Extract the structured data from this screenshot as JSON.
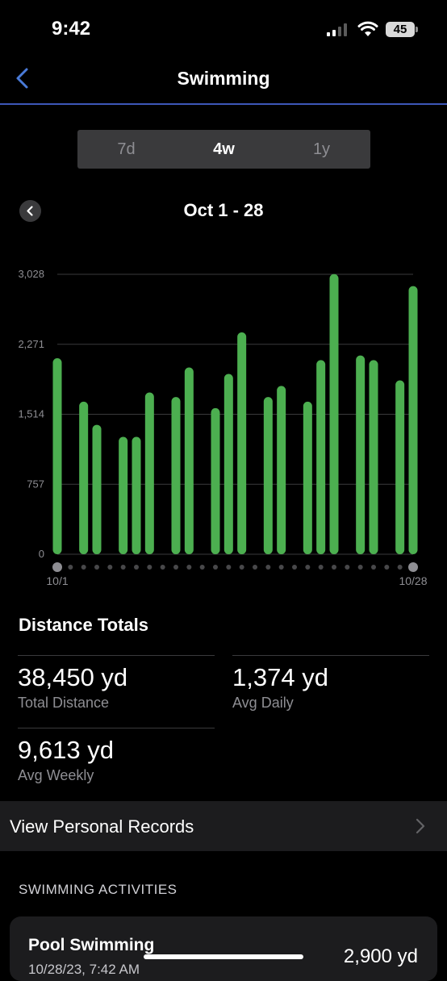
{
  "status_bar": {
    "time": "9:42",
    "battery": "45"
  },
  "nav": {
    "title": "Swimming"
  },
  "segmented": {
    "options": [
      "7d",
      "4w",
      "1y"
    ],
    "selected": "4w"
  },
  "period": {
    "title": "Oct 1 - 28"
  },
  "colors": {
    "bar": "#4caf50",
    "accent": "#3d57b8",
    "background": "#000000"
  },
  "chart_data": {
    "type": "bar",
    "x_start_label": "10/1",
    "x_end_label": "10/28",
    "y_ticks": [
      "0",
      "757",
      "1,514",
      "2,271",
      "3,028"
    ],
    "ylim": [
      0,
      3028
    ],
    "grid": true,
    "categories": [
      "10/1",
      "10/2",
      "10/3",
      "10/4",
      "10/5",
      "10/6",
      "10/7",
      "10/8",
      "10/9",
      "10/10",
      "10/11",
      "10/12",
      "10/13",
      "10/14",
      "10/15",
      "10/16",
      "10/17",
      "10/18",
      "10/19",
      "10/20",
      "10/21",
      "10/22",
      "10/23",
      "10/24",
      "10/25",
      "10/26",
      "10/27",
      "10/28"
    ],
    "values": [
      2120,
      0,
      1650,
      1400,
      0,
      1270,
      1270,
      1750,
      0,
      1700,
      2020,
      0,
      1580,
      1950,
      2400,
      0,
      1700,
      1820,
      0,
      1650,
      2100,
      3030,
      0,
      2150,
      2100,
      0,
      1880,
      2900
    ]
  },
  "totals": {
    "title": "Distance Totals",
    "stats": [
      {
        "value": "38,450 yd",
        "label": "Total Distance"
      },
      {
        "value": "1,374 yd",
        "label": "Avg Daily"
      },
      {
        "value": "9,613 yd",
        "label": "Avg Weekly"
      }
    ]
  },
  "records": {
    "label": "View Personal Records"
  },
  "activities": {
    "header": "SWIMMING ACTIVITIES",
    "items": [
      {
        "name": "Pool Swimming",
        "date": "10/28/23, 7:42 AM",
        "distance": "2,900 yd"
      }
    ]
  }
}
